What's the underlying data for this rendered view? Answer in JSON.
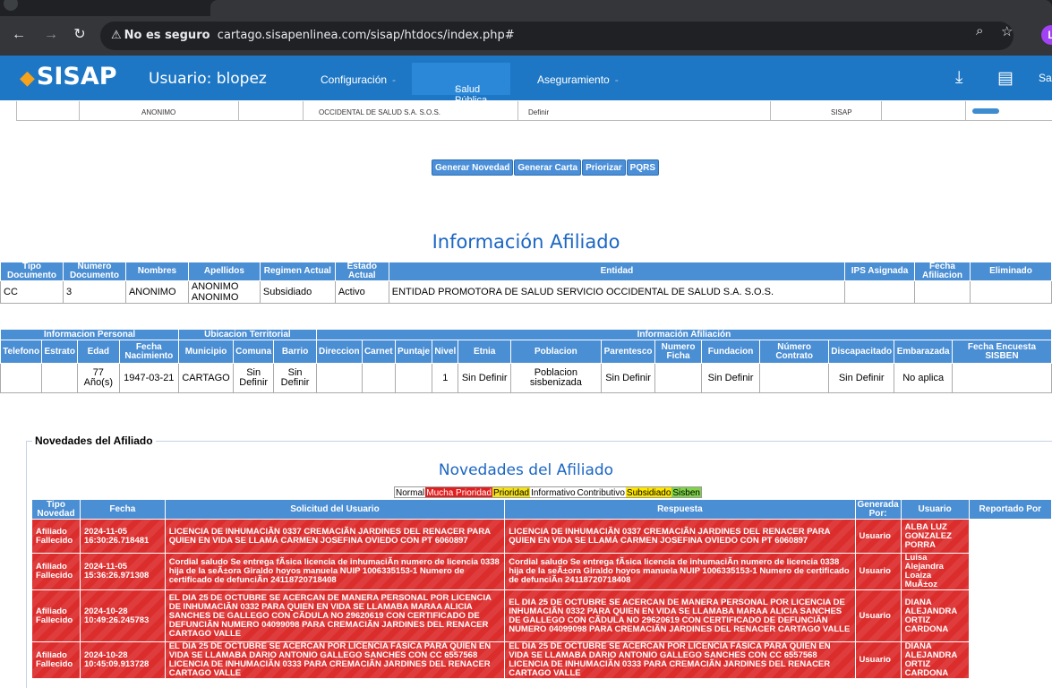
{
  "browser": {
    "security_label": "No es seguro",
    "url": "cartago.sisapenlinea.com/sisap/htdocs/index.php#",
    "profile_initial": "L"
  },
  "app": {
    "logo": "SISAP",
    "user_label": "Usuario: blopez",
    "menu": [
      "Configuración",
      "Salud Pública",
      "Aseguramiento"
    ],
    "menu_caret": "-",
    "right_text": "Sa"
  },
  "partial_row": {
    "cells": [
      "ANONIMO",
      "OCCIDENTAL DE SALUD S.A. S.O.S.",
      "Definir",
      "SISAP"
    ]
  },
  "actions": [
    "Generar Novedad",
    "Generar Carta",
    "Priorizar",
    "PQRS"
  ],
  "info_title": "Información Afiliado",
  "affiliate": {
    "headers": [
      "Tipo Documento",
      "Numero Documento",
      "Nombres",
      "Apellidos",
      "Regimen Actual",
      "Estado Actual",
      "Entidad",
      "IPS Asignada",
      "Fecha Afiliacion",
      "Eliminado"
    ],
    "row": [
      "CC",
      "3",
      "ANONIMO",
      "ANONIMO ANONIMO",
      "Subsidiado",
      "Activo",
      "ENTIDAD PROMOTORA DE SALUD SERVICIO OCCIDENTAL DE SALUD S.A. S.O.S.",
      "",
      "",
      ""
    ]
  },
  "details": {
    "groups": [
      "Informacion Personal",
      "Ubicacion Territorial",
      "Información Afiliación"
    ],
    "headers": [
      "Telefono",
      "Estrato",
      "Edad",
      "Fecha Nacimiento",
      "Municipio",
      "Comuna",
      "Barrio",
      "Direccion",
      "Carnet",
      "Puntaje",
      "Nivel",
      "Etnia",
      "Poblacion",
      "Parentesco",
      "Numero Ficha",
      "Fundacion",
      "Número Contrato",
      "Discapacitado",
      "Embarazada",
      "Fecha Encuesta SISBEN"
    ],
    "row": [
      "",
      "",
      "77 Año(s)",
      "1947-03-21",
      "CARTAGO",
      "Sin Definir",
      "Sin Definir",
      "",
      "",
      "",
      "1",
      "Sin Definir",
      "Poblacion sisbenizada",
      "Sin Definir",
      "",
      "Sin Definir",
      "",
      "Sin Definir",
      "No aplica",
      ""
    ]
  },
  "novedades": {
    "legend_title": "Novedades del Afiliado",
    "title": "Novedades del Afiliado",
    "priority_legend": [
      {
        "label": "Normal",
        "color": "#ffffff",
        "text": "#000000"
      },
      {
        "label": "Mucha Prioridad",
        "color": "#e02020",
        "text": "#ffffff"
      },
      {
        "label": "Prioridad",
        "color": "#f5e11a",
        "text": "#000000"
      },
      {
        "label": "Informativo",
        "color": "#ffffff",
        "text": "#000000"
      },
      {
        "label": "Contributivo",
        "color": "#ffffff",
        "text": "#000000"
      },
      {
        "label": "Subsidiado",
        "color": "#ffe600",
        "text": "#000000"
      },
      {
        "label": "Sisben",
        "color": "#7fd34a",
        "text": "#000000"
      }
    ],
    "headers": [
      "Tipo Novedad",
      "Fecha",
      "Solicitud del Usuario",
      "Respuesta",
      "Generada Por:",
      "Usuario",
      "Reportado Por"
    ],
    "rows": [
      {
        "tipo": "Afiliado Fallecido",
        "fecha": "2024-11-05 16:30:26.718481",
        "solicitud": "LICENCIA DE INHUMACIÃN 0337 CREMACIÃN JARDINES DEL RENACER PARA QUIEN EN VIDA SE LLAMÁ CARMEN JOSEFINA OVIEDO CON PT 6060897",
        "respuesta": "LICENCIA DE INHUMACIÃN 0337 CREMACIÃN JARDINES DEL RENACER PARA QUIEN EN VIDA SE LLAMÁ CARMEN JOSEFINA OVIEDO CON PT 6060897",
        "generada": "Usuario",
        "usuario": "ALBA LUZ GONZALEZ PORRA",
        "reportado": ""
      },
      {
        "tipo": "Afiliado Fallecido",
        "fecha": "2024-11-05 15:36:26.971308",
        "solicitud": "Cordial saludo Se entrega fÃsica licencia de inhumaciÃn numero de licencia 0338 hija de la seÃ±ora Giraldo hoyos manuela NUIP 1006335153-1 Numero de certificado de defunciÃn 24118720718408",
        "respuesta": "Cordial saludo Se entrega fÃsica licencia de inhumaciÃn numero de licencia 0338 hija de la seÃ±ora Giraldo hoyos manuela NUIP 1006335153-1 Numero de certificado de defunciÃn 24118720718408",
        "generada": "Usuario",
        "usuario": "Luisa Alejandra Loaiza MuÃ±oz",
        "reportado": ""
      },
      {
        "tipo": "Afiliado Fallecido",
        "fecha": "2024-10-28 10:49:26.245783",
        "solicitud": "EL DIA 25 DE OCTUBRE SE ACERCAN DE MANERA PERSONAL POR LICENCIA DE INHUMACIÃN 0332 PARA QUIEN EN VIDA SE LLAMABA MARAA ALICIA SANCHES DE GALLEGO CON CÃDULA NO 29620619 CON CERTIFICADO DE DEFUNCIÃN NUMERO 04099098 PARA CREMACIÃN JARDINES DEL RENACER CARTAGO VALLE",
        "respuesta": "EL DIA 25 DE OCTUBRE SE ACERCAN DE MANERA PERSONAL POR LICENCIA DE INHUMACIÃN 0332 PARA QUIEN EN VIDA SE LLAMABA MARAA ALICIA SANCHES DE GALLEGO CON CÃDULA NO 29620619 CON CERTIFICADO DE DEFUNCIÃN NUMERO 04099098 PARA CREMACIÃN JARDINES DEL RENACER CARTAGO VALLE",
        "generada": "Usuario",
        "usuario": "DIANA ALEJANDRA ORTIZ CARDONA",
        "reportado": ""
      },
      {
        "tipo": "Afiliado Fallecido",
        "fecha": "2024-10-28 10:45:09.913728",
        "solicitud": "EL DIA 25 DE OCTUBRE SE ACERCAN POR LICENCIA FÁSICA PARA QUIEN EN VIDA SE LLAMABA DARIO ANTONIO GALLEGO SANCHES CON CC 6557568 LICENCIA DE INHUMACIÃN 0333 PARA CREMACIÃN JARDINES DEL RENACER CARTAGO VALLE",
        "respuesta": "EL DIA 25 DE OCTUBRE SE ACERCAN POR LICENCIA FÁSICA PARA QUIEN EN VIDA SE LLAMABA DARIO ANTONIO GALLEGO SANCHES CON CC 6557568 LICENCIA DE INHUMACIÃN 0333 PARA CREMACIÃN JARDINES DEL RENACER CARTAGO VALLE",
        "generada": "Usuario",
        "usuario": "DIANA ALEJANDRA ORTIZ CARDONA",
        "reportado": ""
      }
    ]
  }
}
